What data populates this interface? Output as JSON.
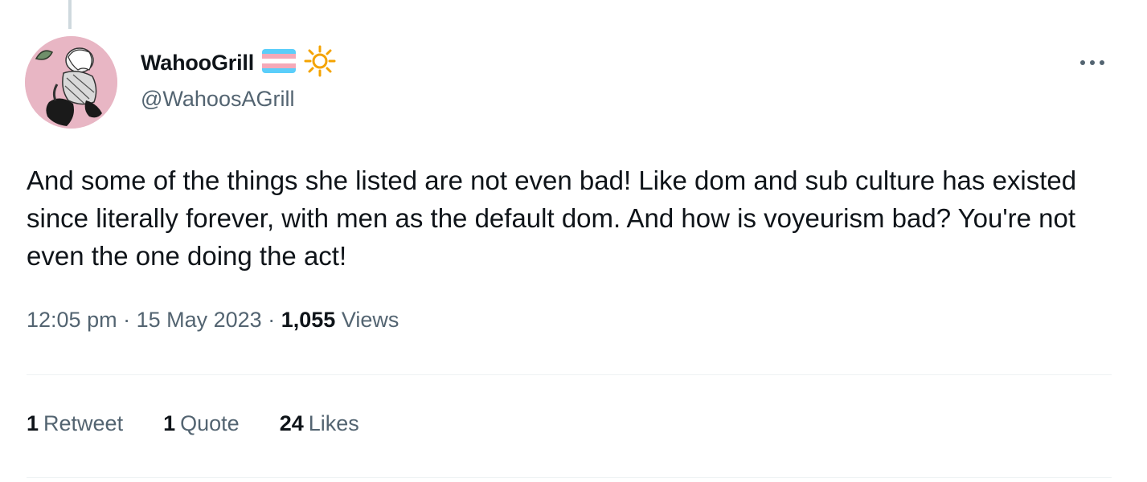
{
  "author": {
    "display_name": "WahooGrill",
    "handle": "@WahoosAGrill",
    "name_emojis": [
      "transgender-flag-icon",
      "sun-icon"
    ]
  },
  "menu": {
    "more_icon": "more-horizontal-icon"
  },
  "tweet": {
    "text": "And some of the things she listed are not even bad! Like dom and sub culture has existed since literally forever, with men as the default dom. And how is voyeurism bad? You're not even the one doing the act!",
    "time": "12:05 pm",
    "date": "15 May 2023",
    "views_count": "1,055",
    "views_label": "Views"
  },
  "stats": {
    "retweets_count": "1",
    "retweets_label": "Retweet",
    "quotes_count": "1",
    "quotes_label": "Quote",
    "likes_count": "24",
    "likes_label": "Likes"
  },
  "colors": {
    "text_primary": "#0f1419",
    "text_secondary": "#536471",
    "divider": "#eff3f4",
    "avatar_bg": "#e8b6c4",
    "trans_blue": "#5bcefa",
    "trans_pink": "#f5a9b8",
    "sun": "#f4a300"
  }
}
